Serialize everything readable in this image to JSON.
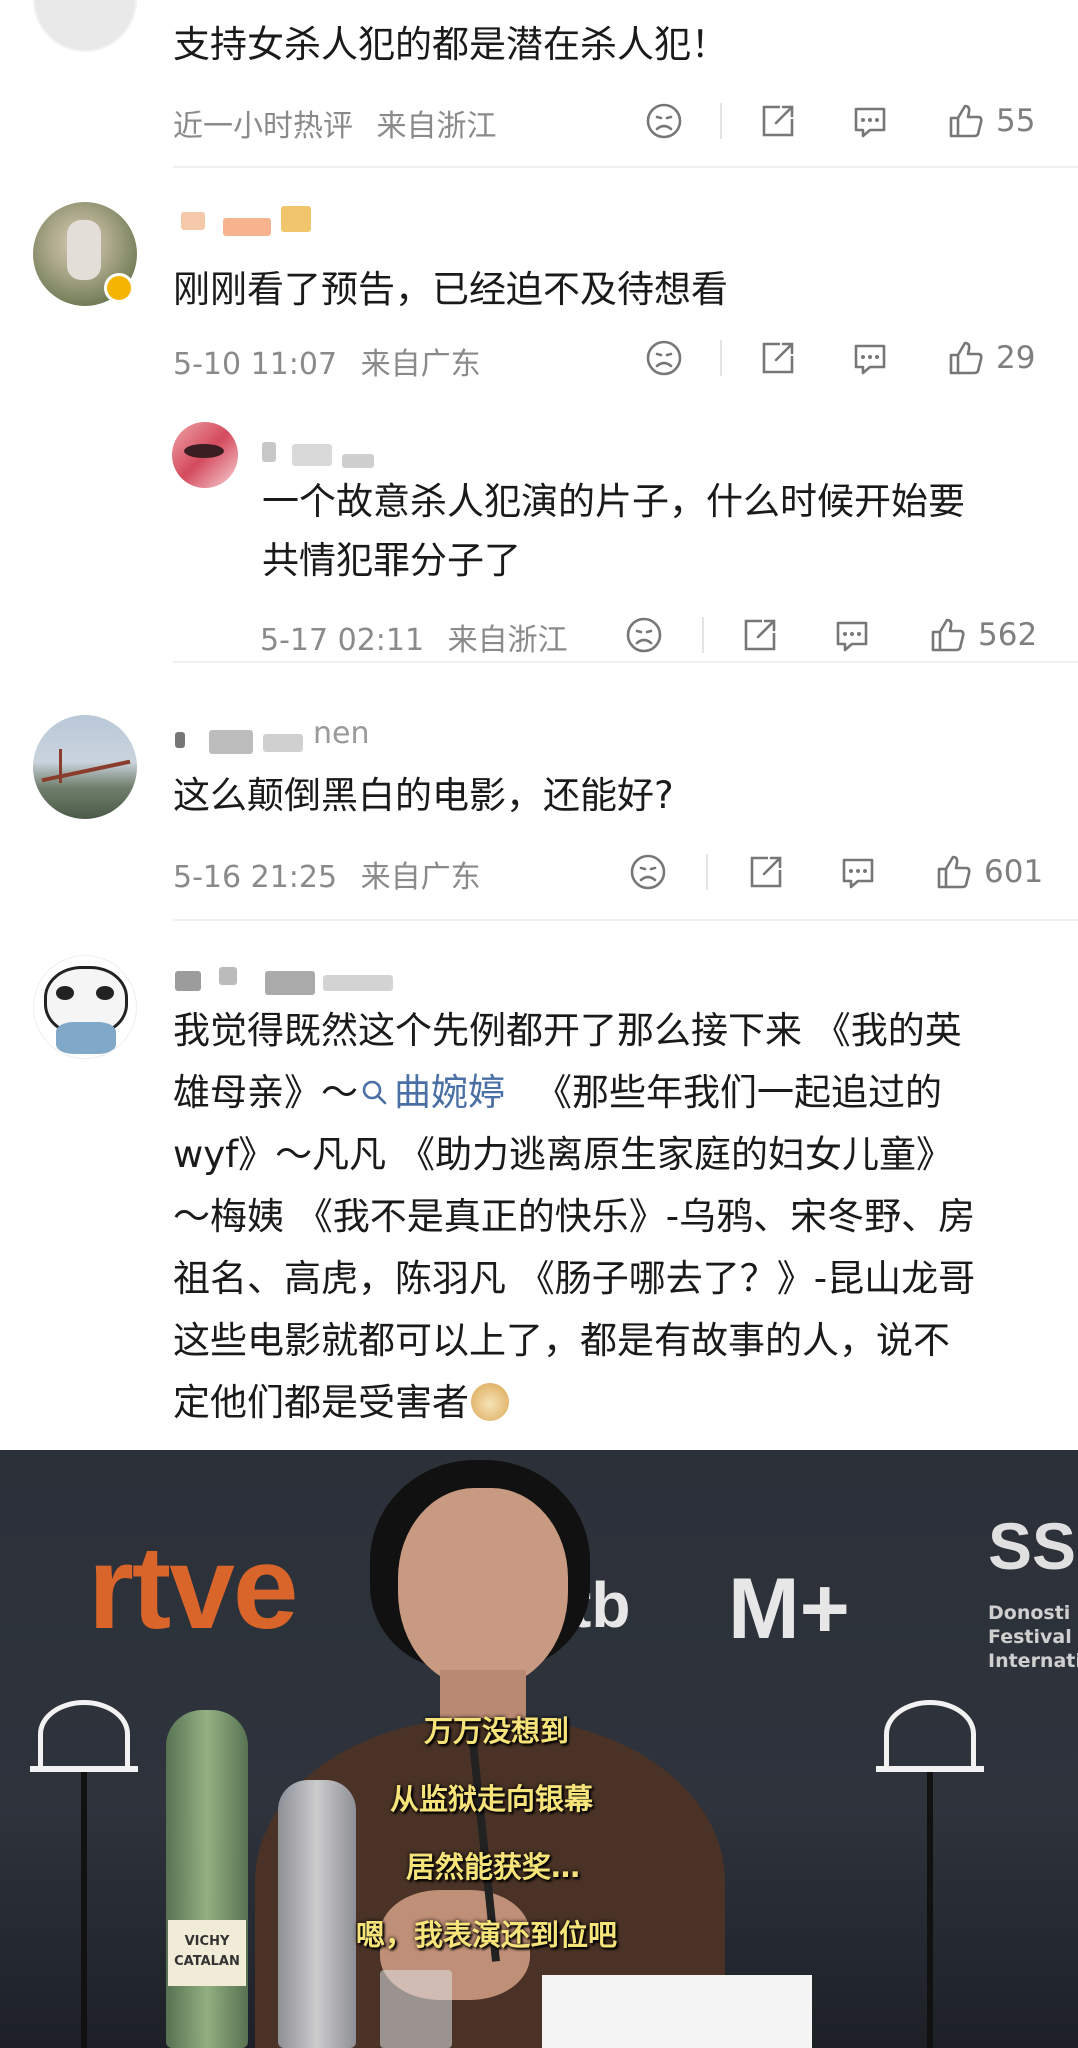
{
  "comments": [
    {
      "text": "支持女杀人犯的都是潜在杀人犯！",
      "time": "近一小时热评",
      "location": "来自浙江",
      "likes": "55"
    },
    {
      "text": "刚刚看了预告，已经迫不及待想看",
      "time": "5-10 11:07",
      "location": "来自广东",
      "likes": "29"
    },
    {
      "text_line1": "一个故意杀人犯演的片子，什么时候开始要",
      "text_line2": "共情犯罪分子了",
      "time": "5-17 02:11",
      "location": "来自浙江",
      "likes": "562"
    },
    {
      "username_fragment": "nen",
      "text": "这么颠倒黑白的电影，还能好?",
      "time": "5-16 21:25",
      "location": "来自广东",
      "likes": "601"
    },
    {
      "lines": [
        "我觉得既然这个先例都开了那么接下来 《我的英",
        "wyf》～凡凡 《助力逃离原生家庭的妇女儿童》",
        "～梅姨 《我不是真正的快乐》-乌鸦、宋冬野、房",
        "祖名、高虎，陈羽凡 《肠子哪去了？》-昆山龙哥",
        "这些电影就都可以上了，都是有故事的人，说不",
        "定他们都是受害者"
      ],
      "line2_prefix": "雄母亲》～",
      "line2_link": "曲婉婷",
      "line2_suffix": "《那些年我们一起追过的"
    }
  ],
  "photo": {
    "logos": [
      "rtve",
      "tb",
      "M+",
      "SS",
      "Donosti",
      "Festival",
      "Internati"
    ],
    "bottle_label": [
      "VICHY",
      "CATALAN"
    ],
    "subtitles": [
      "万万没想到",
      "从监狱走向银幕",
      "居然能获奖…",
      "嗯，我表演还到位吧"
    ]
  },
  "icons": [
    "dislike-icon",
    "share-icon",
    "reply-icon",
    "like-icon"
  ],
  "colors": {
    "meta": "#8a8a8a",
    "link": "#4a6fa5",
    "subtitle": "#f6e47a"
  }
}
